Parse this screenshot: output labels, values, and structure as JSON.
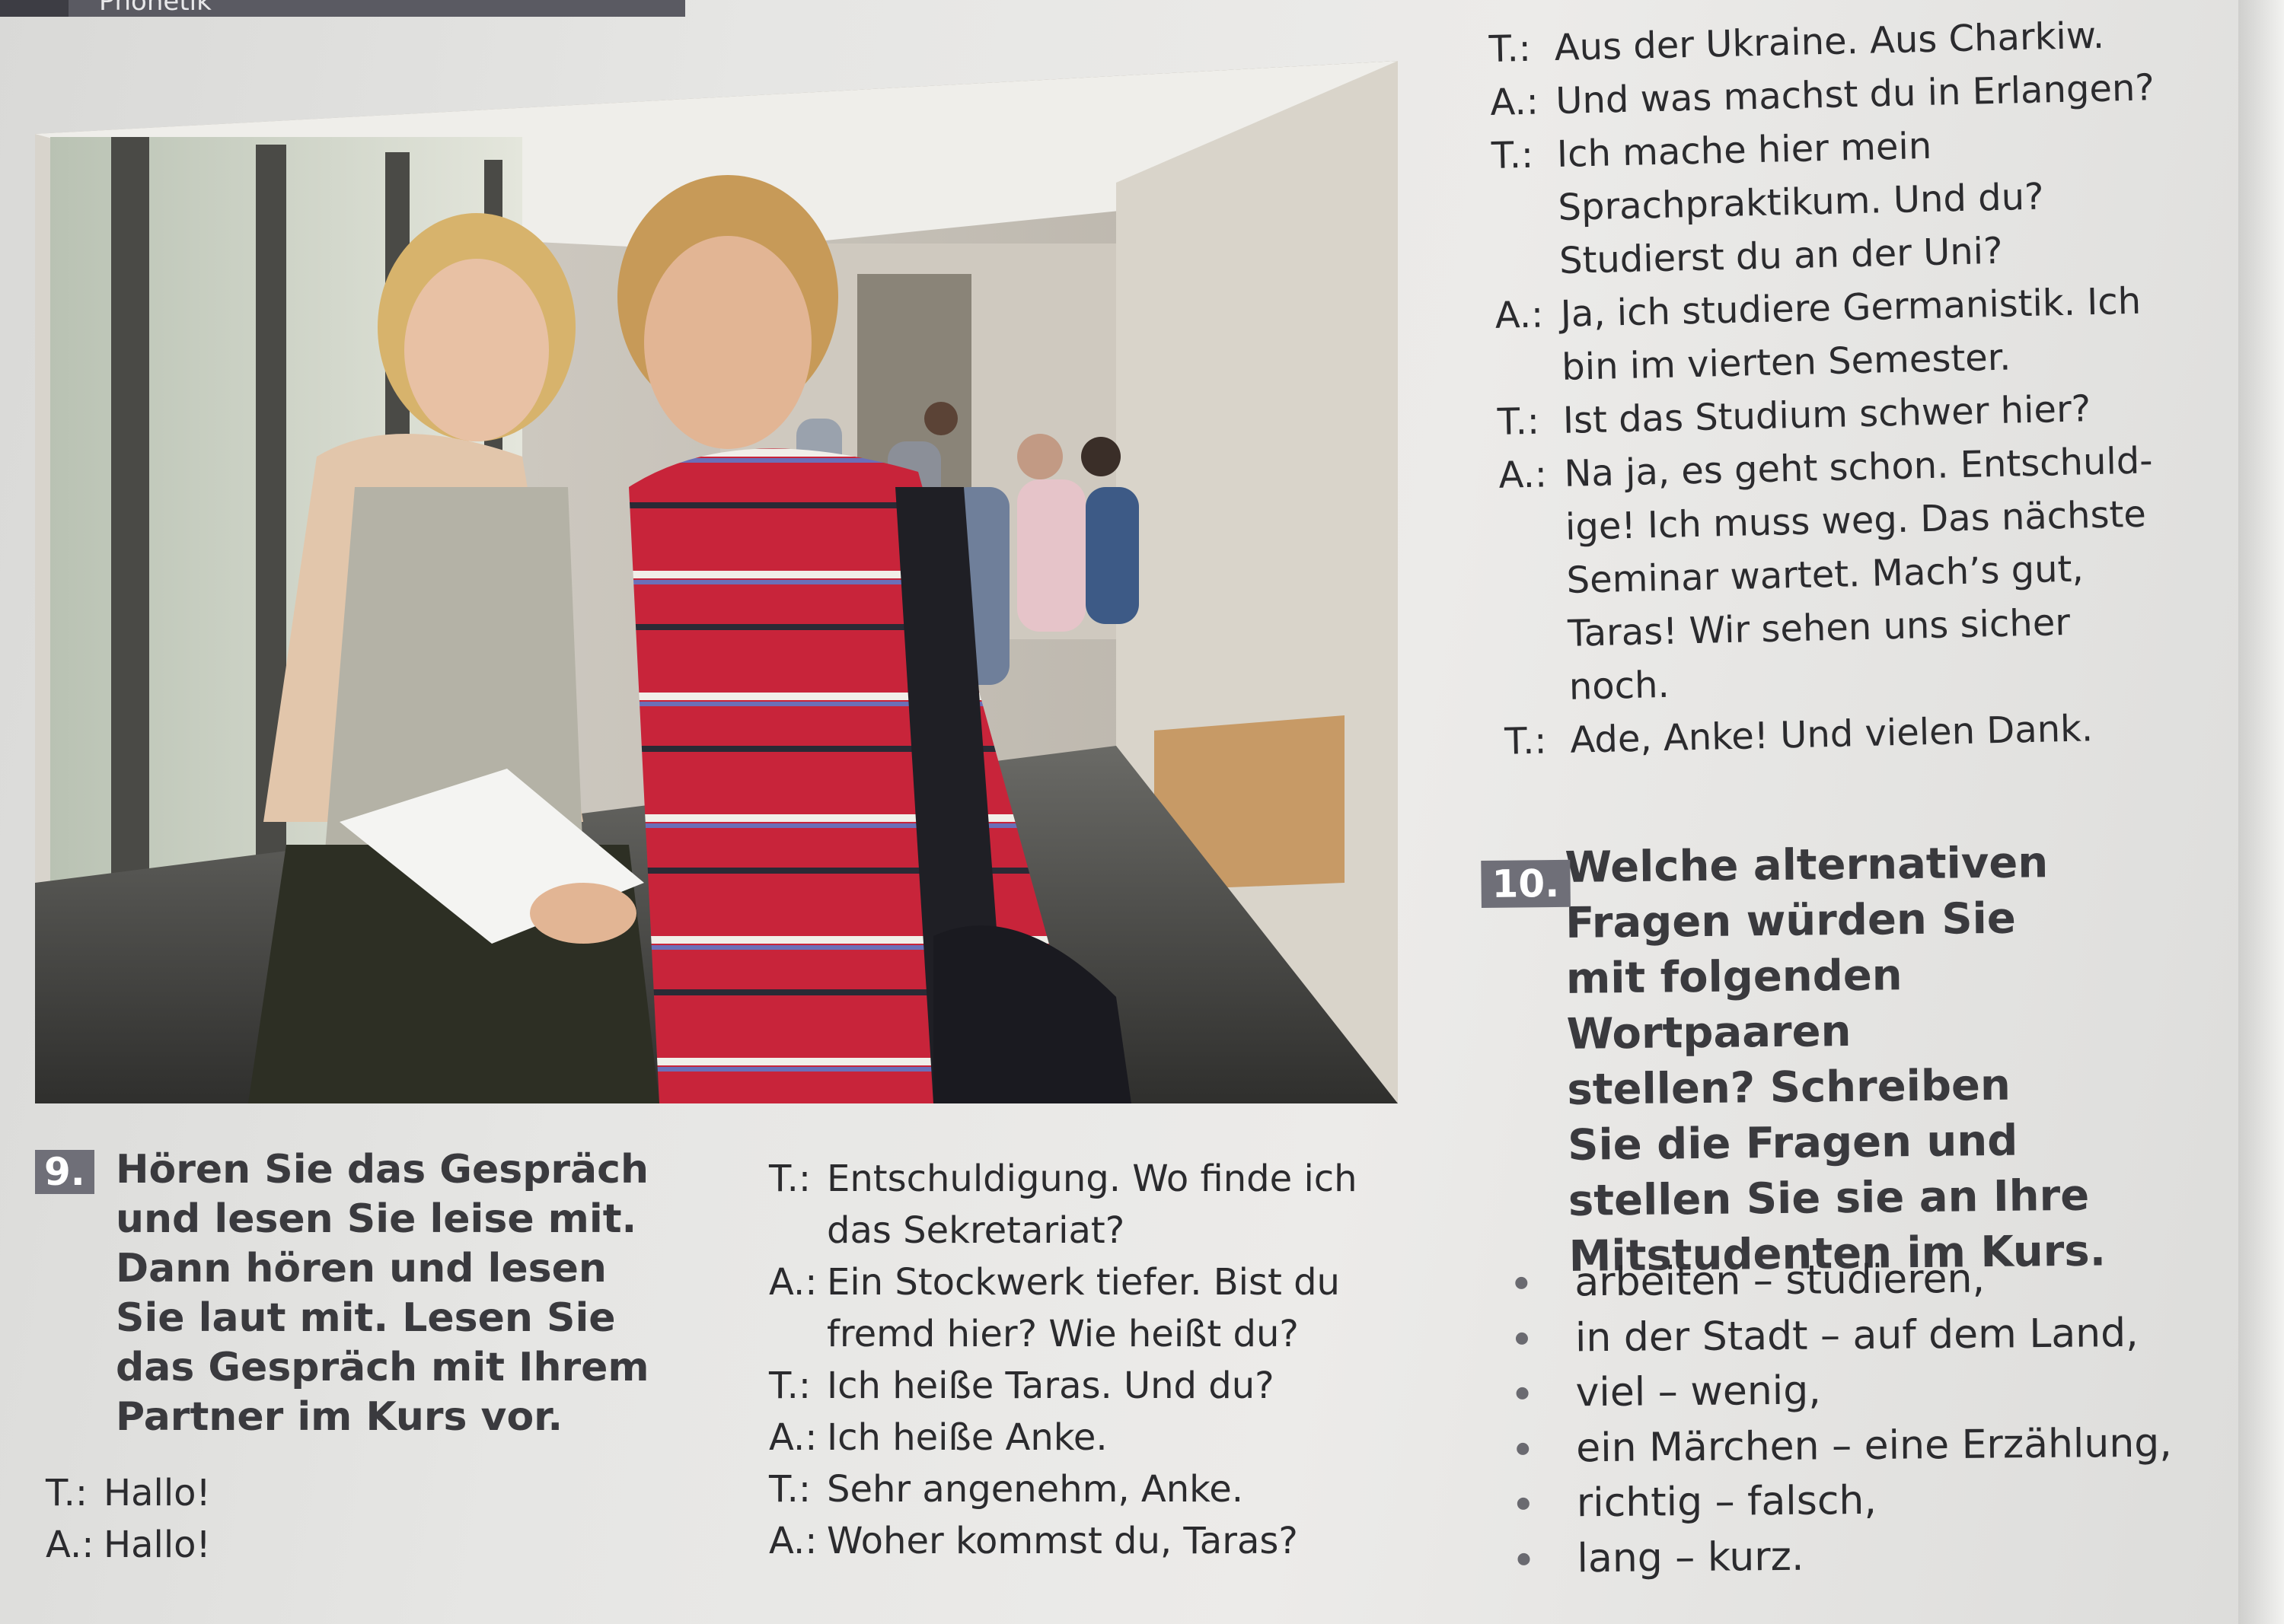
{
  "header": {
    "title": "Phonetik"
  },
  "photo": {
    "description_icon": "students-in-corridor-photo"
  },
  "dialog_right": [
    {
      "speaker": "T.:",
      "text": "Aus der Ukraine. Aus Charkiw."
    },
    {
      "speaker": "A.:",
      "text": "Und was machst du in Erlangen?"
    },
    {
      "speaker": "T.:",
      "text": "Ich mache hier mein"
    },
    {
      "speaker": "",
      "text": "Sprachpraktikum. Und du?"
    },
    {
      "speaker": "",
      "text": "Studierst du an der Uni?"
    },
    {
      "speaker": "A.:",
      "text": "Ja, ich studiere Germanistik. Ich"
    },
    {
      "speaker": "",
      "text": "bin im vierten Semester."
    },
    {
      "speaker": "T.:",
      "text": "Ist das Studium schwer hier?"
    },
    {
      "speaker": "A.:",
      "text": "Na ja, es geht schon. Entschuld-"
    },
    {
      "speaker": "",
      "text": "ige! Ich muss weg. Das nächste"
    },
    {
      "speaker": "",
      "text": "Seminar wartet. Mach’s gut,"
    },
    {
      "speaker": "",
      "text": "Taras! Wir sehen uns sicher"
    },
    {
      "speaker": "",
      "text": "noch."
    },
    {
      "speaker": "T.:",
      "text": "Ade, Anke! Und vielen Dank."
    }
  ],
  "task10": {
    "number": "10.",
    "lines": [
      "Welche alternativen",
      "Fragen würden Sie",
      "mit folgenden Wortpaaren",
      "stellen? Schreiben",
      "Sie die Fragen und",
      "stellen Sie sie an Ihre",
      "Mitstudenten im Kurs."
    ],
    "pairs": [
      "arbeiten – studieren,",
      "in der Stadt – auf dem Land,",
      "viel – wenig,",
      "ein Märchen – eine Erzählung,",
      "richtig – falsch,",
      "lang – kurz."
    ]
  },
  "task9": {
    "number": "9.",
    "lines": [
      "Hören Sie das Gespräch",
      "und lesen Sie leise mit.",
      "Dann hören und lesen",
      "Sie laut mit. Lesen Sie",
      "das Gespräch mit Ihrem",
      "Partner im Kurs vor."
    ]
  },
  "dialog_left": [
    {
      "speaker": "T.:",
      "text": "Hallo!"
    },
    {
      "speaker": "A.:",
      "text": "Hallo!"
    }
  ],
  "dialog_middle": [
    {
      "speaker": "T.:",
      "text": "Entschuldigung. Wo finde ich"
    },
    {
      "speaker": "",
      "text": "das Sekretariat?"
    },
    {
      "speaker": "A.:",
      "text": "Ein Stockwerk tiefer. Bist du"
    },
    {
      "speaker": "",
      "text": "fremd hier? Wie heißt du?"
    },
    {
      "speaker": "T.:",
      "text": "Ich heiße Taras. Und du?"
    },
    {
      "speaker": "A.:",
      "text": "Ich heiße Anke."
    },
    {
      "speaker": "T.:",
      "text": "Sehr angenehm, Anke."
    },
    {
      "speaker": "A.:",
      "text": "Woher kommst du, Taras?"
    }
  ]
}
